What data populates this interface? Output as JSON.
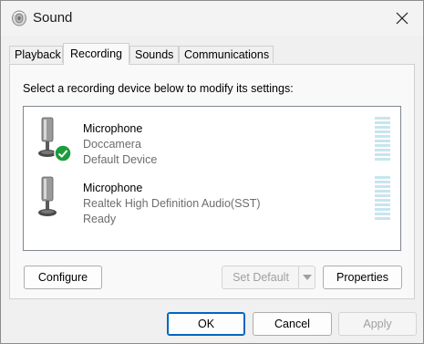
{
  "window": {
    "title": "Sound",
    "title_icon": "speaker-icon",
    "close_icon": "close-icon"
  },
  "tabs": [
    {
      "label": "Playback",
      "active": false
    },
    {
      "label": "Recording",
      "active": true
    },
    {
      "label": "Sounds",
      "active": false
    },
    {
      "label": "Communications",
      "active": false
    }
  ],
  "panel": {
    "instruction": "Select a recording device below to modify its settings:"
  },
  "devices": [
    {
      "name": "Microphone",
      "description": "Doccamera",
      "status": "Default Device",
      "icon": "microphone-icon",
      "badge": "default-check-icon",
      "badge_color": "#1c9c3c"
    },
    {
      "name": "Microphone",
      "description": "Realtek High Definition Audio(SST)",
      "status": "Ready",
      "icon": "microphone-icon"
    }
  ],
  "buttons": {
    "configure": "Configure",
    "set_default": "Set Default",
    "properties": "Properties",
    "ok": "OK",
    "cancel": "Cancel",
    "apply": "Apply"
  },
  "colors": {
    "accent": "#0067c0",
    "level_meter": "#c8e5ef"
  }
}
